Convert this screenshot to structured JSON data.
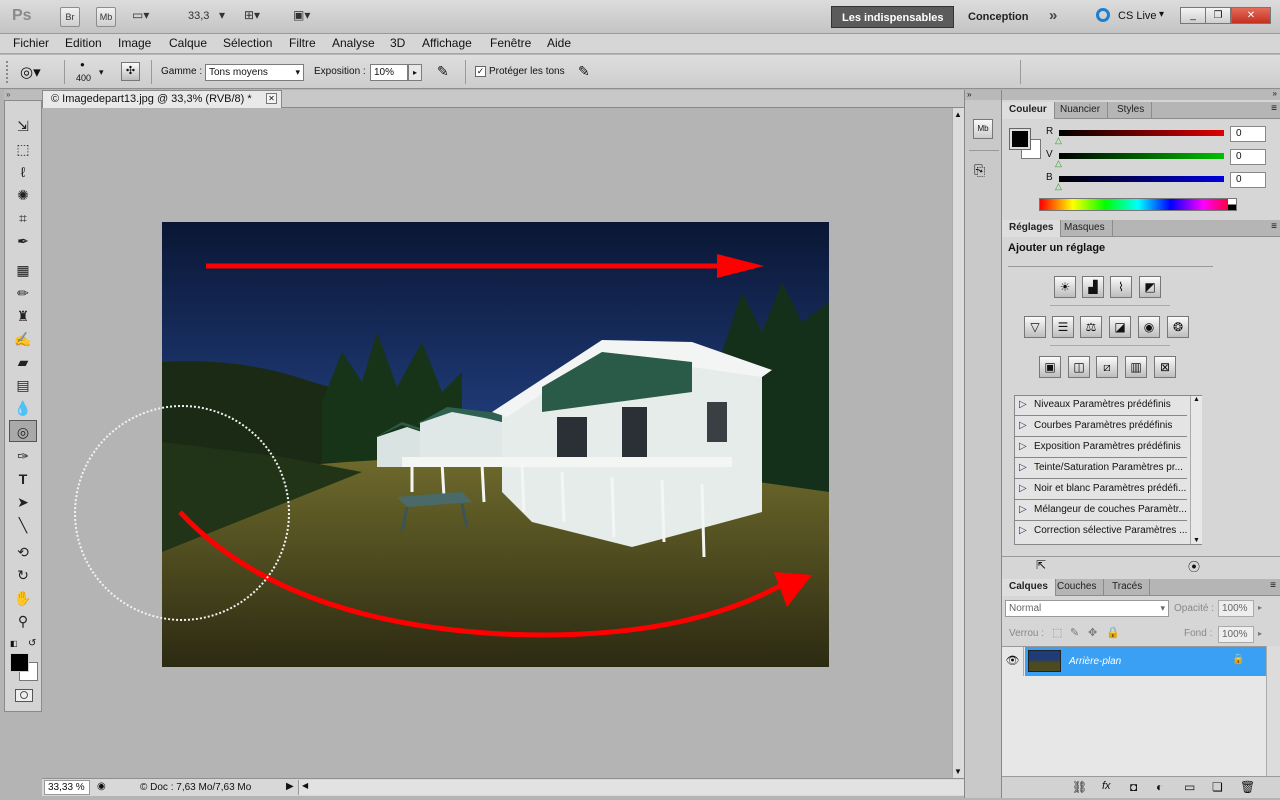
{
  "app": {
    "logo": "Ps",
    "bridge": "Br",
    "minibridge": "Mb",
    "zoom_value": "33,3",
    "workspaces": [
      "Les indispensables",
      "Conception"
    ],
    "more_workspaces": "»",
    "cslive": "CS Live",
    "window_controls": {
      "minimize": "_",
      "restore": "❐",
      "close": "✕"
    }
  },
  "menu": [
    "Fichier",
    "Edition",
    "Image",
    "Calque",
    "Sélection",
    "Filtre",
    "Analyse",
    "3D",
    "Affichage",
    "Fenêtre",
    "Aide"
  ],
  "options": {
    "brush_size": "400",
    "gamme_label": "Gamme :",
    "gamme_value": "Tons moyens",
    "exposition_label": "Exposition :",
    "exposition_value": "10%",
    "proteger_label": "Protéger les tons",
    "proteger_checked": true
  },
  "document": {
    "tab_title": "© Imagedepart13.jpg @ 33,3% (RVB/8) *",
    "close": "✕",
    "status_zoom": "33,33 %",
    "status_doc": "© Doc : 7,63 Mo/7,63 Mo"
  },
  "color_panel": {
    "tabs": [
      "Couleur",
      "Nuancier",
      "Styles"
    ],
    "channels": [
      {
        "label": "R",
        "value": "0",
        "color": "#e00000"
      },
      {
        "label": "V",
        "value": "0",
        "color": "#00c000"
      },
      {
        "label": "B",
        "value": "0",
        "color": "#0000e0"
      }
    ]
  },
  "adjust_panel": {
    "tabs": [
      "Réglages",
      "Masques"
    ],
    "heading": "Ajouter un réglage",
    "presets": [
      "Niveaux Paramètres prédéfinis",
      "Courbes Paramètres prédéfinis",
      "Exposition Paramètres prédéfinis",
      "Teinte/Saturation Paramètres pr...",
      "Noir et blanc Paramètres prédéfi...",
      "Mélangeur de couches Paramètr...",
      "Correction sélective Paramètres ..."
    ]
  },
  "layers_panel": {
    "tabs": [
      "Calques",
      "Couches",
      "Tracés"
    ],
    "blend_mode": "Normal",
    "opacity_label": "Opacité :",
    "opacity_value": "100%",
    "lock_label": "Verrou :",
    "fill_label": "Fond :",
    "fill_value": "100%",
    "layer_name": "Arrière-plan"
  },
  "colors": {
    "accent_blue": "#3aa0f4",
    "arrow_red": "#ff0000"
  }
}
